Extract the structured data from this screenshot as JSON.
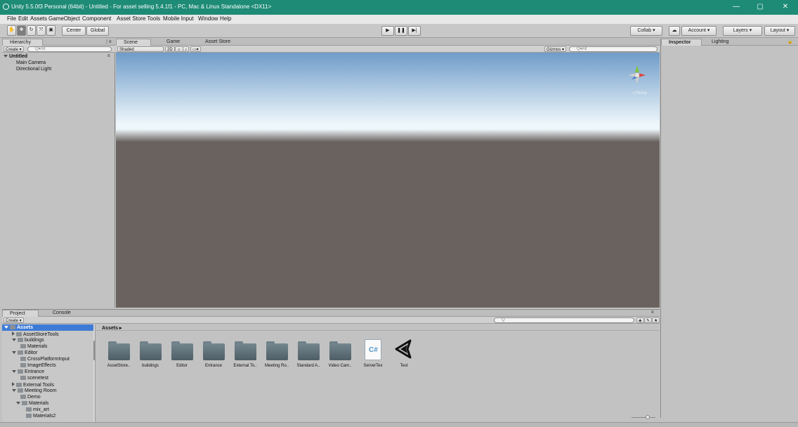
{
  "window": {
    "title": "Unity 5.5.0f3 Personal (64bit) - Untitled - For asset selling 5.4.1f1 - PC, Mac & Linux Standalone <DX11>",
    "minimize": "—",
    "maximize": "▢",
    "close": "✕"
  },
  "menu": [
    "File",
    "Edit",
    "Assets",
    "GameObject",
    "Component",
    "Asset Store Tools",
    "Mobile Input",
    "Window",
    "Help"
  ],
  "toolbar": {
    "pivot": "Center",
    "space": "Global",
    "play": "▶",
    "pause": "❚❚",
    "step": "▶|",
    "collab": "Collab ▾",
    "cloud": "☁",
    "account": "Account ▾",
    "layers": "Layers ▾",
    "layout": "Layout ▾"
  },
  "hierarchy": {
    "tab": "Hierarchy",
    "create": "Create ▾",
    "search_placeholder": "Q▾All",
    "scene_name": "Untitled",
    "items": [
      "Main Camera",
      "Directional Light"
    ]
  },
  "scene": {
    "tabs": [
      "Scene",
      "Game",
      "Asset Store"
    ],
    "shading": "Shaded",
    "mode_2d": "2D",
    "gizmos": "Gizmos ▾",
    "search_placeholder": "Q▾All",
    "persp": "◁ Persp",
    "colors": {
      "sky_top": "#6f9cc9",
      "horizon": "#eef7fb",
      "ground": "#6a625f"
    }
  },
  "inspector": {
    "tabs": [
      "Inspector",
      "Lighting"
    ]
  },
  "project": {
    "tabs": [
      "Project",
      "Console"
    ],
    "create": "Create ▾",
    "breadcrumb": "Assets ▸",
    "search_placeholder": "Q",
    "tree": [
      {
        "label": "Assets",
        "selected": true
      },
      {
        "label": "AssetStoreTools"
      },
      {
        "label": "buildings"
      },
      {
        "label": "Materials"
      },
      {
        "label": "Editor"
      },
      {
        "label": "CrossPlatformInput"
      },
      {
        "label": "ImageEffects"
      },
      {
        "label": "Entrance"
      },
      {
        "label": "scenetest"
      },
      {
        "label": "External Tools"
      },
      {
        "label": "Meeting Room"
      },
      {
        "label": "Demo"
      },
      {
        "label": "Materials"
      },
      {
        "label": "mix_art"
      },
      {
        "label": "Materials2"
      }
    ],
    "assets": [
      {
        "label": "AssetStore..",
        "type": "folder"
      },
      {
        "label": "buildings",
        "type": "folder"
      },
      {
        "label": "Editor",
        "type": "folder"
      },
      {
        "label": "Entrance",
        "type": "folder"
      },
      {
        "label": "External To..",
        "type": "folder"
      },
      {
        "label": "Meeting Ro..",
        "type": "folder"
      },
      {
        "label": "Standard A..",
        "type": "folder"
      },
      {
        "label": "Video Cam..",
        "type": "folder"
      },
      {
        "label": "ServerTex",
        "type": "script",
        "glyph": "C#"
      },
      {
        "label": "Test",
        "type": "scene"
      }
    ]
  }
}
